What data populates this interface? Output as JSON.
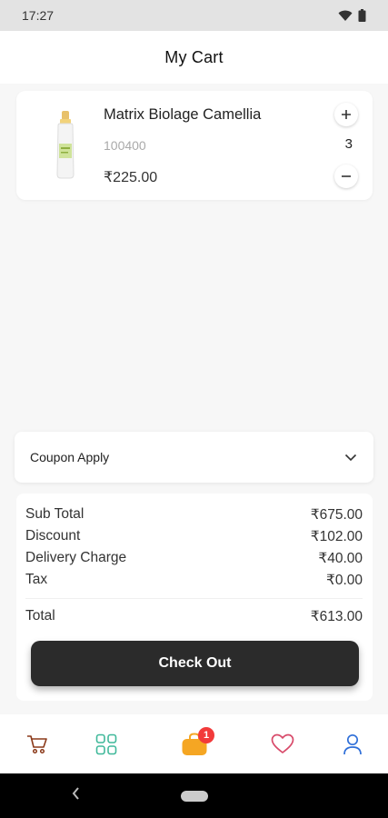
{
  "status": {
    "time": "17:27"
  },
  "app": {
    "title": "My Cart"
  },
  "cart": {
    "items": [
      {
        "name": "Matrix Biolage Camellia",
        "code": "100400",
        "price": "₹225.00",
        "quantity": "3"
      }
    ]
  },
  "coupon": {
    "label": "Coupon Apply"
  },
  "summary": {
    "subtotal_label": "Sub Total",
    "subtotal_value": "₹675.00",
    "discount_label": "Discount",
    "discount_value": "₹102.00",
    "delivery_label": "Delivery Charge",
    "delivery_value": "₹40.00",
    "tax_label": "Tax",
    "tax_value": "₹0.00",
    "total_label": "Total",
    "total_value": "₹613.00"
  },
  "checkout": {
    "label": "Check Out"
  },
  "nav": {
    "items": [
      {
        "icon": "cart-icon",
        "color": "#8b3a1a"
      },
      {
        "icon": "grid-icon",
        "color": "#3fb89a"
      },
      {
        "icon": "bag-icon",
        "color": "#f5a623",
        "badge": "1"
      },
      {
        "icon": "heart-icon",
        "color": "#d84a6a"
      },
      {
        "icon": "user-icon",
        "color": "#2f6fd8"
      }
    ]
  },
  "colors": {
    "accent_dark": "#2b2b2b",
    "badge": "#f23a3a"
  }
}
